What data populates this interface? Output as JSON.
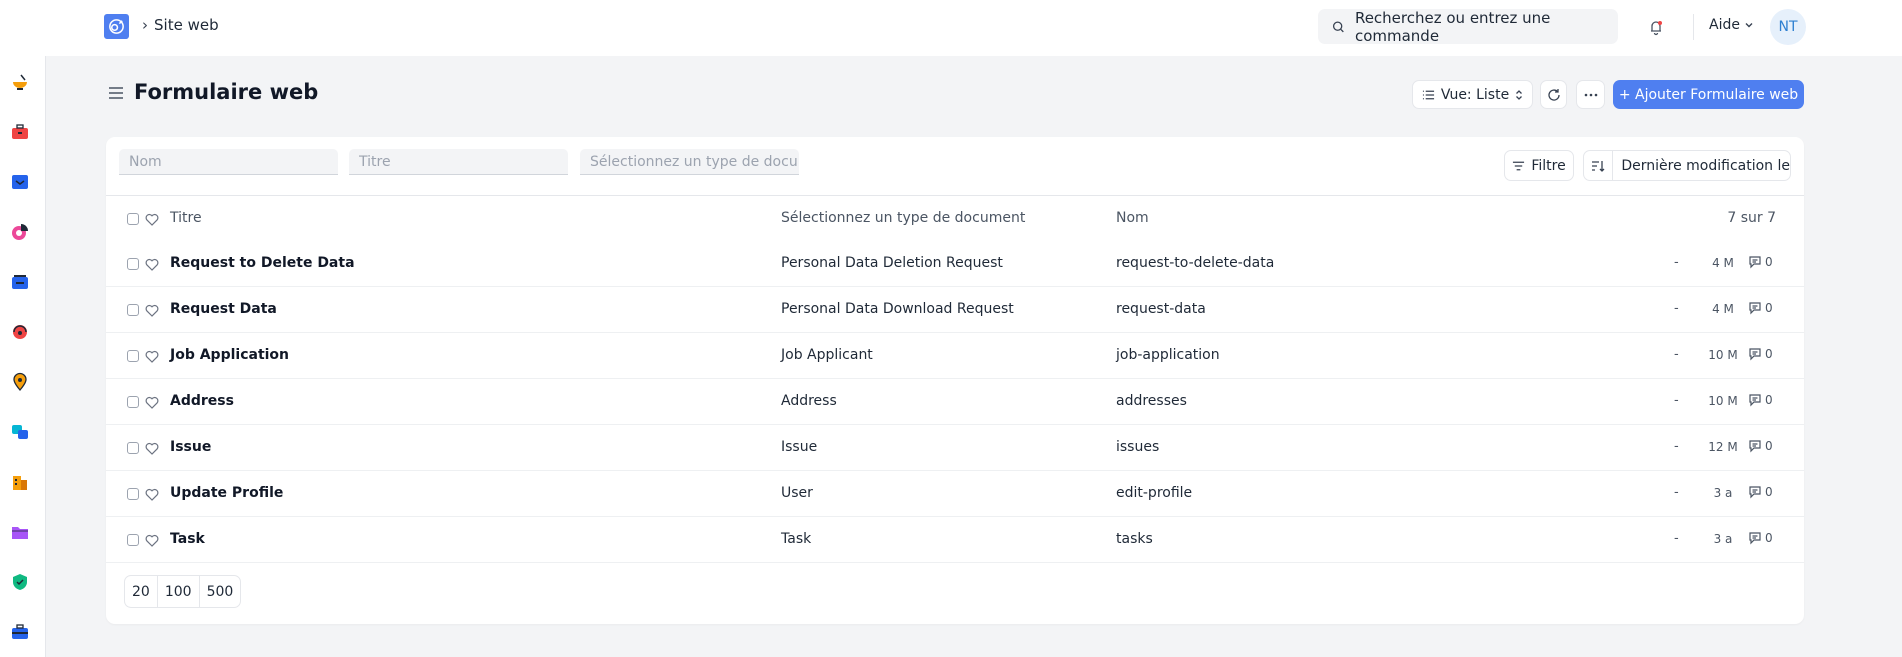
{
  "topbar": {
    "breadcrumb": "Site web",
    "search_placeholder": "Recherchez ou entrez une commande",
    "help_label": "Aide",
    "avatar_initials": "NT"
  },
  "page": {
    "title": "Formulaire web",
    "view_label": "Vue: Liste",
    "add_label": "+ Ajouter Formulaire web"
  },
  "filters": {
    "name_placeholder": "Nom",
    "title_placeholder": "Titre",
    "doctype_placeholder": "Sélectionnez un type de docum",
    "filter_label": "Filtre",
    "sort_label": "Dernière modification le"
  },
  "table": {
    "headers": {
      "title": "Titre",
      "doctype": "Sélectionnez un type de document",
      "name": "Nom",
      "count": "7 sur 7"
    },
    "rows": [
      {
        "title": "Request to Delete Data",
        "doctype": "Personal Data Deletion Request",
        "name": "request-to-delete-data",
        "dash": "-",
        "time": "4 M",
        "comments": "0"
      },
      {
        "title": "Request Data",
        "doctype": "Personal Data Download Request",
        "name": "request-data",
        "dash": "-",
        "time": "4 M",
        "comments": "0"
      },
      {
        "title": "Job Application",
        "doctype": "Job Applicant",
        "name": "job-application",
        "dash": "-",
        "time": "10 M",
        "comments": "0"
      },
      {
        "title": "Address",
        "doctype": "Address",
        "name": "addresses",
        "dash": "-",
        "time": "10 M",
        "comments": "0"
      },
      {
        "title": "Issue",
        "doctype": "Issue",
        "name": "issues",
        "dash": "-",
        "time": "12 M",
        "comments": "0"
      },
      {
        "title": "Update Profile",
        "doctype": "User",
        "name": "edit-profile",
        "dash": "-",
        "time": "3 a",
        "comments": "0"
      },
      {
        "title": "Task",
        "doctype": "Task",
        "name": "tasks",
        "dash": "-",
        "time": "3 a",
        "comments": "0"
      }
    ]
  },
  "pagination": [
    "20",
    "100",
    "500"
  ],
  "sidebar": {
    "icons": [
      "bowl-icon",
      "toolbox-icon",
      "inbox-icon",
      "pie-chart-icon",
      "stack-icon",
      "headset-icon",
      "map-pin-icon",
      "squares-icon",
      "building-icon",
      "folder-icon",
      "shield-icon",
      "briefcase-icon"
    ]
  },
  "colors": {
    "accent": "#4f7ff0",
    "background": "#f3f4f6"
  }
}
